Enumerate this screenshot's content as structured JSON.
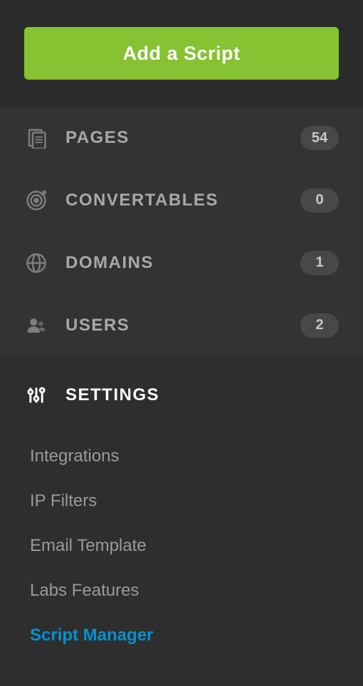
{
  "button": {
    "add_script": "Add a Script"
  },
  "nav": [
    {
      "label": "PAGES",
      "count": "54"
    },
    {
      "label": "CONVERTABLES",
      "count": "0"
    },
    {
      "label": "DOMAINS",
      "count": "1"
    },
    {
      "label": "USERS",
      "count": "2"
    }
  ],
  "settings": {
    "label": "SETTINGS",
    "items": [
      {
        "label": "Integrations"
      },
      {
        "label": "IP Filters"
      },
      {
        "label": "Email Template"
      },
      {
        "label": "Labs Features"
      },
      {
        "label": "Script Manager"
      }
    ]
  }
}
